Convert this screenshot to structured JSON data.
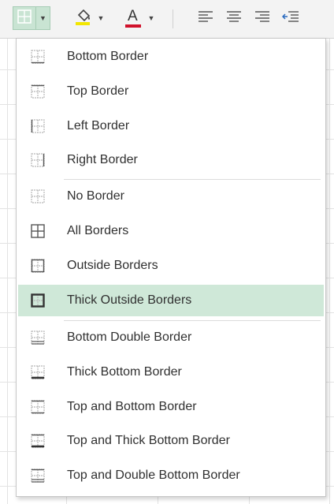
{
  "colors": {
    "accent_green": "#cfe8d8",
    "fill_yellow": "#f2e600",
    "font_red": "#d0112b"
  },
  "ribbon": {
    "buttons": [
      {
        "name": "borders-button",
        "icon": "borders-icon"
      },
      {
        "name": "fill-color-button",
        "icon": "paint-bucket-icon"
      },
      {
        "name": "font-color-button",
        "icon": "font-color-icon"
      },
      {
        "name": "align-left-button",
        "icon": "align-left-icon"
      },
      {
        "name": "align-center-button",
        "icon": "align-center-icon"
      },
      {
        "name": "align-right-button",
        "icon": "align-right-icon"
      },
      {
        "name": "decrease-indent-button",
        "icon": "decrease-indent-icon"
      }
    ],
    "font_color_glyph": "A"
  },
  "menu": {
    "selected_index": 7,
    "items": [
      {
        "label": "Bottom Border",
        "icon": "bottom-border-icon"
      },
      {
        "label": "Top Border",
        "icon": "top-border-icon"
      },
      {
        "label": "Left Border",
        "icon": "left-border-icon"
      },
      {
        "label": "Right Border",
        "icon": "right-border-icon"
      },
      {
        "label": "No Border",
        "icon": "no-border-icon"
      },
      {
        "label": "All Borders",
        "icon": "all-borders-icon"
      },
      {
        "label": "Outside Borders",
        "icon": "outside-borders-icon"
      },
      {
        "label": "Thick Outside Borders",
        "icon": "thick-outside-borders-icon"
      },
      {
        "label": "Bottom Double Border",
        "icon": "bottom-double-border-icon"
      },
      {
        "label": "Thick Bottom Border",
        "icon": "thick-bottom-border-icon"
      },
      {
        "label": "Top and Bottom Border",
        "icon": "top-and-bottom-border-icon"
      },
      {
        "label": "Top and Thick Bottom Border",
        "icon": "top-and-thick-bottom-border-icon"
      },
      {
        "label": "Top and Double Bottom Border",
        "icon": "top-and-double-bottom-border-icon"
      }
    ]
  }
}
